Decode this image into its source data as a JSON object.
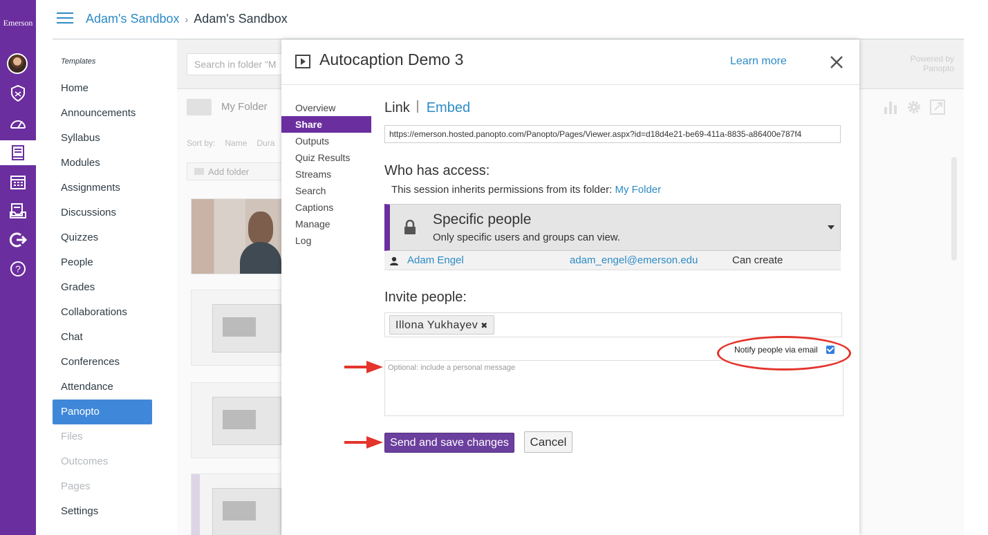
{
  "global_nav": {
    "brand": "Emerson",
    "icons": [
      "account-avatar",
      "admin-shield-icon",
      "dashboard-gauge-icon",
      "courses-book-icon",
      "calendar-icon",
      "inbox-icon",
      "commons-arrow-icon",
      "help-icon"
    ]
  },
  "header": {
    "crumb_1": "Adam's Sandbox",
    "crumb_2": "Adam's Sandbox"
  },
  "course_nav": {
    "section_label": "Templates",
    "items": [
      {
        "label": "Home"
      },
      {
        "label": "Announcements"
      },
      {
        "label": "Syllabus"
      },
      {
        "label": "Modules"
      },
      {
        "label": "Assignments"
      },
      {
        "label": "Discussions"
      },
      {
        "label": "Quizzes"
      },
      {
        "label": "People"
      },
      {
        "label": "Grades"
      },
      {
        "label": "Collaborations"
      },
      {
        "label": "Chat"
      },
      {
        "label": "Conferences"
      },
      {
        "label": "Attendance"
      },
      {
        "label": "Panopto"
      },
      {
        "label": "Files"
      },
      {
        "label": "Outcomes"
      },
      {
        "label": "Pages"
      },
      {
        "label": "Settings"
      }
    ]
  },
  "panopto_bg": {
    "search_placeholder": "Search in folder \"M",
    "powered_1": "Powered by",
    "powered_2": "Panopto",
    "folder": "My Folder",
    "sort_by": "Sort by:",
    "sort_name": "Name",
    "sort_dur": "Dura",
    "add_folder": "Add folder"
  },
  "modal": {
    "title": "Autocaption Demo 3",
    "learn_more": "Learn more",
    "nav": [
      {
        "label": "Overview"
      },
      {
        "label": "Share"
      },
      {
        "label": "Outputs"
      },
      {
        "label": "Quiz Results"
      },
      {
        "label": "Streams"
      },
      {
        "label": "Search"
      },
      {
        "label": "Captions"
      },
      {
        "label": "Manage"
      },
      {
        "label": "Log"
      }
    ],
    "tab_link": "Link",
    "tab_embed": "Embed",
    "url": "https://emerson.hosted.panopto.com/Panopto/Pages/Viewer.aspx?id=d18d4e21-be69-411a-8835-a86400e787f4",
    "who_heading": "Who has access:",
    "inherit_text": "This session inherits permissions from its folder:",
    "inherit_folder": "My Folder",
    "perm_title": "Specific people",
    "perm_sub": "Only specific users and groups can view.",
    "user": {
      "name": "Adam Engel",
      "email": "adam_engel@emerson.edu",
      "role": "Can create"
    },
    "invite_heading": "Invite people:",
    "invitee": "Illona Yukhayev",
    "notify_label": "Notify people via email",
    "message_placeholder": "Optional: include a personal message",
    "send_label": "Send and save changes",
    "cancel_label": "Cancel"
  },
  "colors": {
    "brand_purple": "#6b2e9e",
    "link_blue": "#2d8bc5",
    "annotation_red": "#e3352c"
  }
}
